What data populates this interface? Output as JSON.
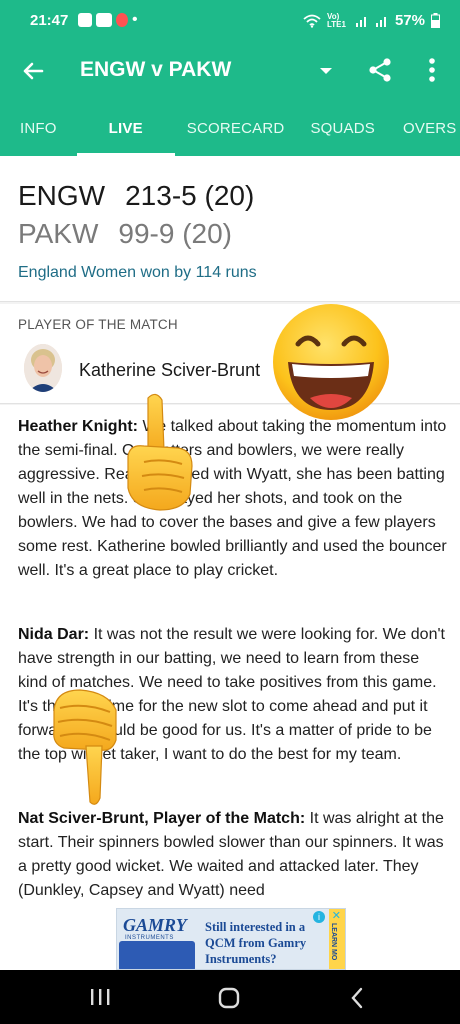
{
  "status_bar": {
    "time": "21:47",
    "notif_dot": "•",
    "network_label": "Vo) LTE1",
    "battery": "57%"
  },
  "header": {
    "title": "ENGW v PAKW"
  },
  "tabs": [
    {
      "label": "INFO",
      "active": false
    },
    {
      "label": "LIVE",
      "active": true
    },
    {
      "label": "SCORECARD",
      "active": false
    },
    {
      "label": "SQUADS",
      "active": false
    },
    {
      "label": "OVERS",
      "active": false
    }
  ],
  "score": {
    "team1": {
      "name": "ENGW",
      "score": "213-5 (20)"
    },
    "team2": {
      "name": "PAKW",
      "score": "99-9 (20)"
    },
    "result": "England Women won by 114 runs"
  },
  "player_of_match": {
    "label": "PLAYER OF THE MATCH",
    "name": "Katherine Sciver-Brunt"
  },
  "quotes": [
    {
      "speaker": "Heather Knight:",
      "text": "We talked about taking the momentum into the semi-final. Our batters and bowlers, we were really aggressive. Really pleased with Wyatt, she has been batting well in the nets. She played her shots, and took on the bowlers. We had to cover the bases and give a few players some rest. Katherine bowled brilliantly and used the bouncer well. It's a great place to play cricket."
    },
    {
      "speaker": "Nida Dar:",
      "text": "It was not the result we were looking for. We don't have strength in our batting, we need to learn from these kind of matches. We need to take positives from this game. It's the best time for the new slot to come ahead and put it forward. It would be good for us. It's a matter of pride to be the top wicket taker, I want to do the best for my team."
    },
    {
      "speaker": "Nat Sciver-Brunt, Player of the Match:",
      "text": "It was alright at the start. Their spinners bowled slower than our spinners. It was a pretty good wicket. We waited and attacked later. They (Dunkley, Capsey and Wyatt) need"
    }
  ],
  "ad": {
    "brand": "GAMRY",
    "brand_sub": "INSTRUMENTS",
    "text": "Still interested in a QCM from Gamry Instruments?",
    "side_label": "LEARN MO",
    "info_glyph": "i",
    "close_glyph": "✕"
  },
  "colors": {
    "header_bg": "#1eba8a",
    "result_text": "#1f6d86"
  }
}
